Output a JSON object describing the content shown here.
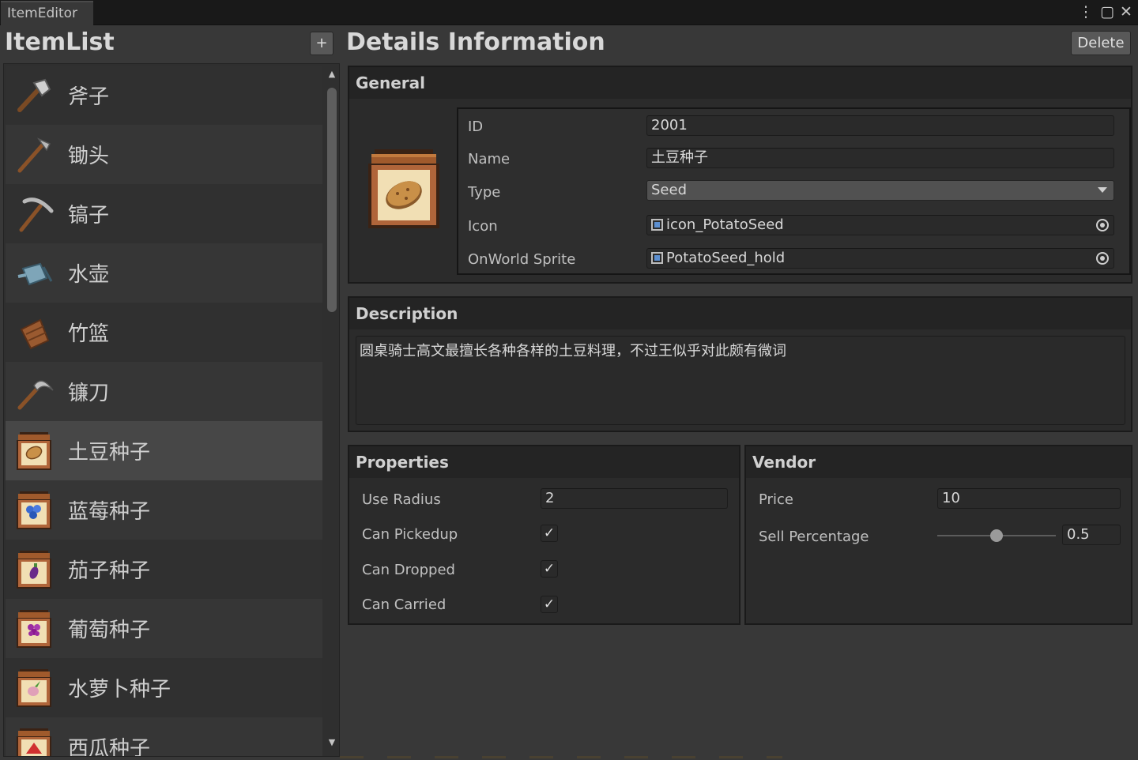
{
  "window": {
    "tab_title": "ItemEditor",
    "menu_glyph": "⋮",
    "maximize_glyph": "▢",
    "close_glyph": "✕"
  },
  "item_list": {
    "title": "ItemList",
    "add_label": "+",
    "scroll_up": "▲",
    "scroll_down": "▼",
    "items": [
      {
        "label": "斧子",
        "icon": "axe-icon"
      },
      {
        "label": "锄头",
        "icon": "hoe-icon"
      },
      {
        "label": "镐子",
        "icon": "pickaxe-icon"
      },
      {
        "label": "水壶",
        "icon": "watering-can-icon"
      },
      {
        "label": "竹篮",
        "icon": "basket-icon"
      },
      {
        "label": "镰刀",
        "icon": "sickle-icon"
      },
      {
        "label": "土豆种子",
        "icon": "potato-seed-icon",
        "selected": true
      },
      {
        "label": "蓝莓种子",
        "icon": "blueberry-seed-icon"
      },
      {
        "label": "茄子种子",
        "icon": "eggplant-seed-icon"
      },
      {
        "label": "葡萄种子",
        "icon": "grape-seed-icon"
      },
      {
        "label": "水萝卜种子",
        "icon": "radish-seed-icon"
      },
      {
        "label": "西瓜种子",
        "icon": "watermelon-seed-icon"
      }
    ]
  },
  "details": {
    "title": "Details Information",
    "delete_label": "Delete",
    "general": {
      "header": "General",
      "preview_icon": "potato-seed-icon",
      "id_label": "ID",
      "id_value": "2001",
      "name_label": "Name",
      "name_value": "土豆种子",
      "type_label": "Type",
      "type_value": "Seed",
      "icon_label": "Icon",
      "icon_value": "icon_PotatoSeed",
      "sprite_label": "OnWorld Sprite",
      "sprite_value": "PotatoSeed_hold"
    },
    "description": {
      "header": "Description",
      "text": "圆桌骑士高文最擅长各种各样的土豆料理，不过王似乎对此颇有微词"
    },
    "properties": {
      "header": "Properties",
      "use_radius_label": "Use Radius",
      "use_radius_value": "2",
      "can_pickup_label": "Can Pickedup",
      "can_pickup": true,
      "can_dropped_label": "Can Dropped",
      "can_dropped": true,
      "can_carried_label": "Can Carried",
      "can_carried": true,
      "check_glyph": "✓"
    },
    "vendor": {
      "header": "Vendor",
      "price_label": "Price",
      "price_value": "10",
      "sell_label": "Sell Percentage",
      "sell_value": "0.5",
      "sell_fraction": 0.5
    }
  },
  "colors": {
    "background": "#383838",
    "panel": "#2b2b2b",
    "header": "#242424",
    "selected_row": "#474747"
  }
}
